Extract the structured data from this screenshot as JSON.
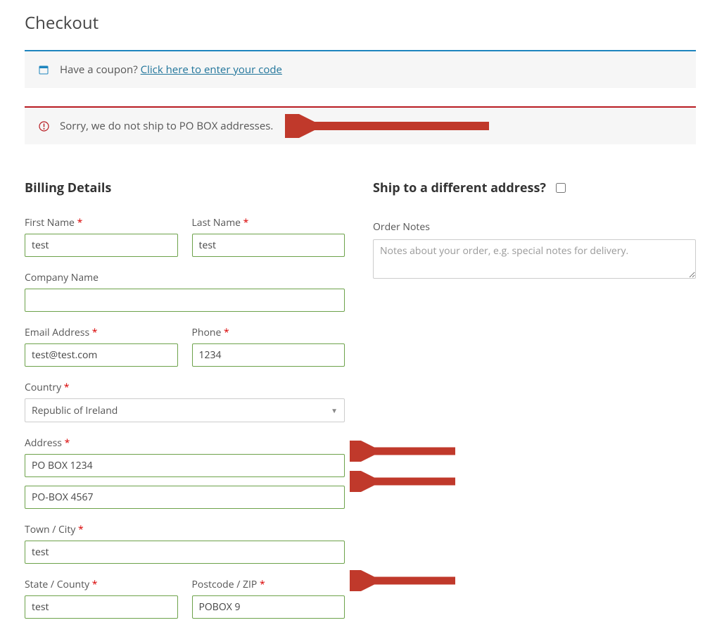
{
  "page": {
    "title": "Checkout"
  },
  "coupon_notice": {
    "prompt": "Have a coupon? ",
    "link_text": "Click here to enter your code"
  },
  "error_notice": {
    "message": "Sorry, we do not ship to PO BOX addresses."
  },
  "billing": {
    "heading": "Billing Details",
    "first_name": {
      "label": "First Name",
      "required": true,
      "value": "test"
    },
    "last_name": {
      "label": "Last Name",
      "required": true,
      "value": "test"
    },
    "company": {
      "label": "Company Name",
      "required": false,
      "value": ""
    },
    "email": {
      "label": "Email Address",
      "required": true,
      "value": "test@test.com"
    },
    "phone": {
      "label": "Phone",
      "required": true,
      "value": "1234"
    },
    "country": {
      "label": "Country",
      "required": true,
      "selected": "Republic of Ireland"
    },
    "address": {
      "label": "Address",
      "required": true,
      "line1": "PO BOX 1234",
      "line2": "PO-BOX 4567"
    },
    "city": {
      "label": "Town / City",
      "required": true,
      "value": "test"
    },
    "state": {
      "label": "State / County",
      "required": true,
      "value": "test"
    },
    "postcode": {
      "label": "Postcode / ZIP",
      "required": true,
      "value": "POBOX 9"
    }
  },
  "shipping": {
    "heading": "Ship to a different address?",
    "diff_checked": false,
    "notes_label": "Order Notes",
    "notes_placeholder": "Notes about your order, e.g. special notes for delivery.",
    "notes_value": ""
  },
  "colors": {
    "accent_info": "#1e85be",
    "accent_error": "#b81c23",
    "input_valid_border": "#6da24a",
    "required_star": "#d90000",
    "annotation_arrow": "#c0392b"
  }
}
